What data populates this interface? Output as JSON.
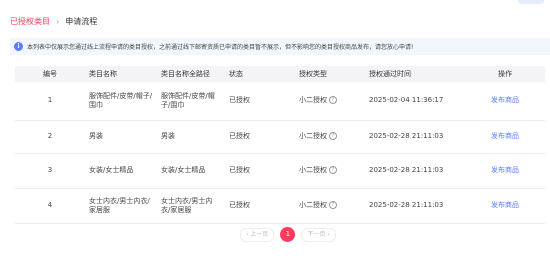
{
  "breadcrumb": {
    "parent": "已授权类目",
    "separator": "›",
    "current": "申请流程"
  },
  "notice": {
    "icon": "info-icon",
    "text": "本列表中仅展示您通过线上流程申请的类目授权，之前通过线下邮寄资质已申请的类目暂不展示，但不影响您的类目授权商品发布，请您放心申请!"
  },
  "table": {
    "headers": [
      "编号",
      "类目名称",
      "类目名称全路径",
      "状态",
      "授权类型",
      "授权通过时间",
      "操作"
    ],
    "rows": [
      {
        "id": "1",
        "name": "服饰配件/皮带/帽子/围巾",
        "path": "服饰配件/皮带/帽子/围巾",
        "status": "已授权",
        "auth_type": "小二授权",
        "time": "2025-02-04 11:36:17",
        "action": "发布商品"
      },
      {
        "id": "2",
        "name": "男装",
        "path": "男装",
        "status": "已授权",
        "auth_type": "小二授权",
        "time": "2025-02-28 21:11:03",
        "action": "发布商品"
      },
      {
        "id": "3",
        "name": "女装/女士精品",
        "path": "女装/女士精品",
        "status": "已授权",
        "auth_type": "小二授权",
        "time": "2025-02-28 21:11:03",
        "action": "发布商品"
      },
      {
        "id": "4",
        "name": "女士内衣/男士内衣/家居服",
        "path": "女士内衣/男士内衣/家居服",
        "status": "已授权",
        "auth_type": "小二授权",
        "time": "2025-02-28 21:11:03",
        "action": "发布商品"
      }
    ]
  },
  "pagination": {
    "prev": "‹ 上一页",
    "current": "1",
    "next": "下一页 ›"
  },
  "colors": {
    "accent": "#ff3b5c",
    "link": "#5b7cff"
  }
}
